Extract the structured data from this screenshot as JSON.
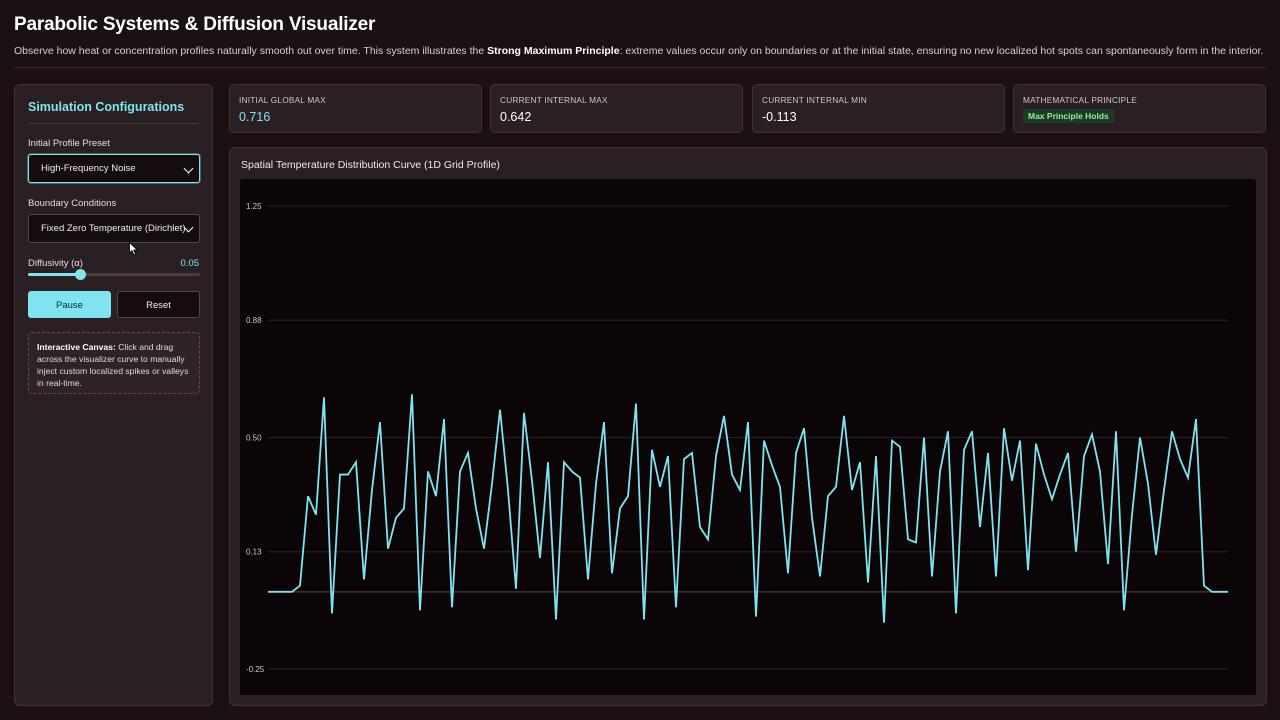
{
  "header": {
    "title": "Parabolic Systems & Diffusion Visualizer",
    "desc_before": "Observe how heat or concentration profiles naturally smooth out over time. This system illustrates the ",
    "desc_bold": "Strong Maximum Principle",
    "desc_after": ": extreme values occur only on boundaries or at the initial state, ensuring no new localized hot spots can spontaneously form in the interior."
  },
  "sidebar": {
    "title": "Simulation Configurations",
    "preset_label": "Initial Profile Preset",
    "preset_value": "High-Frequency Noise",
    "boundary_label": "Boundary Conditions",
    "boundary_value": "Fixed Zero Temperature (Dirichlet)",
    "diffusivity_label": "Diffusivity (α)",
    "diffusivity_value": "0.05",
    "diffusivity_fraction": 0.3,
    "pause_label": "Pause",
    "reset_label": "Reset",
    "info_bold": "Interactive Canvas:",
    "info_text": " Click and drag across the visualizer curve to manually inject custom localized spikes or valleys in real-time."
  },
  "stats": [
    {
      "label": "INITIAL GLOBAL MAX",
      "value": "0.716"
    },
    {
      "label": "CURRENT INTERNAL MAX",
      "value": "0.642"
    },
    {
      "label": "CURRENT INTERNAL MIN",
      "value": "-0.113"
    },
    {
      "label": "MATHEMATICAL PRINCIPLE",
      "badge": "Max Principle Holds"
    }
  ],
  "colors": {
    "accent": "#7fe4f0",
    "success": "#8ff09a",
    "background": "#1b1113",
    "panel": "#2a2023",
    "canvas": "#0c0507"
  },
  "chart_data": {
    "type": "line",
    "title": "Spatial Temperature Distribution Curve (1D Grid Profile)",
    "ylim": [
      -0.25,
      1.25
    ],
    "yticks": [
      1.25,
      0.88,
      0.5,
      0.13,
      -0.25
    ],
    "ytick_labels": [
      "1.25",
      "0.88",
      "0.50",
      "0.13",
      "-0.25"
    ],
    "grid": true,
    "baseline": 0,
    "series": [
      {
        "color": "#7fe4f0",
        "values": [
          0,
          0,
          0,
          0,
          0.02,
          0.31,
          0.25,
          0.63,
          -0.07,
          0.38,
          0.38,
          0.42,
          0.04,
          0.33,
          0.55,
          0.14,
          0.24,
          0.27,
          0.64,
          -0.06,
          0.39,
          0.31,
          0.56,
          -0.05,
          0.39,
          0.45,
          0.27,
          0.14,
          0.35,
          0.59,
          0.33,
          0.01,
          0.58,
          0.36,
          0.11,
          0.42,
          -0.09,
          0.42,
          0.39,
          0.37,
          0.04,
          0.35,
          0.55,
          0.06,
          0.27,
          0.31,
          0.61,
          -0.09,
          0.46,
          0.34,
          0.44,
          -0.05,
          0.43,
          0.45,
          0.21,
          0.17,
          0.44,
          0.57,
          0.38,
          0.33,
          0.55,
          -0.08,
          0.49,
          0.41,
          0.34,
          0.06,
          0.45,
          0.53,
          0.24,
          0.05,
          0.31,
          0.34,
          0.57,
          0.33,
          0.42,
          0.03,
          0.44,
          -0.1,
          0.49,
          0.47,
          0.17,
          0.16,
          0.5,
          0.05,
          0.39,
          0.52,
          -0.07,
          0.46,
          0.52,
          0.21,
          0.45,
          0.05,
          0.53,
          0.36,
          0.49,
          0.07,
          0.48,
          0.38,
          0.3,
          0.38,
          0.45,
          0.13,
          0.44,
          0.51,
          0.39,
          0.09,
          0.52,
          -0.06,
          0.25,
          0.5,
          0.35,
          0.12,
          0.33,
          0.52,
          0.43,
          0.37,
          0.56,
          0.02,
          0.0,
          0.0,
          0.0
        ]
      }
    ]
  }
}
